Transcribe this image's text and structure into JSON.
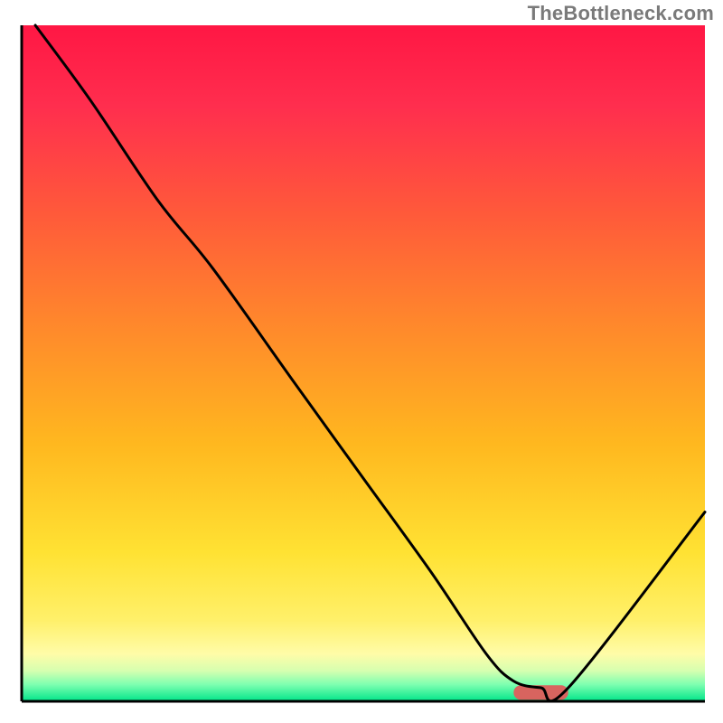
{
  "watermark": "TheBottleneck.com",
  "chart_data": {
    "type": "line",
    "title": "",
    "xlabel": "",
    "ylabel": "",
    "xlim": [
      0,
      100
    ],
    "ylim": [
      0,
      100
    ],
    "series": [
      {
        "name": "curve",
        "x": [
          2,
          10,
          20,
          28,
          40,
          50,
          60,
          68,
          72,
          76,
          80,
          100
        ],
        "y": [
          100,
          89,
          74,
          64,
          47,
          33,
          19,
          7,
          3,
          2,
          2,
          28
        ]
      }
    ],
    "marker": {
      "x_range": [
        72,
        80
      ],
      "y": 1.3
    },
    "gradient_stops": [
      {
        "offset": 0.0,
        "color": "#ff1744"
      },
      {
        "offset": 0.12,
        "color": "#ff2e4e"
      },
      {
        "offset": 0.28,
        "color": "#ff5a3a"
      },
      {
        "offset": 0.45,
        "color": "#ff8a2b"
      },
      {
        "offset": 0.62,
        "color": "#ffb81f"
      },
      {
        "offset": 0.78,
        "color": "#ffe233"
      },
      {
        "offset": 0.88,
        "color": "#fff06a"
      },
      {
        "offset": 0.93,
        "color": "#fffca8"
      },
      {
        "offset": 0.955,
        "color": "#d6ffb0"
      },
      {
        "offset": 0.975,
        "color": "#7effb0"
      },
      {
        "offset": 1.0,
        "color": "#00e58a"
      }
    ]
  }
}
